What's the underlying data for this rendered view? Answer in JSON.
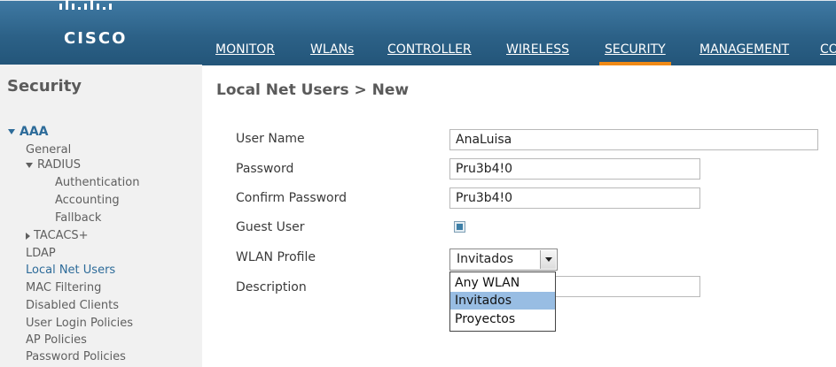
{
  "brand": {
    "name": "CISCO"
  },
  "nav": {
    "items": [
      {
        "label": "MONITOR"
      },
      {
        "label": "WLANs"
      },
      {
        "label": "CONTROLLER"
      },
      {
        "label": "WIRELESS"
      },
      {
        "label": "SECURITY",
        "active": true
      },
      {
        "label": "MANAGEMENT"
      },
      {
        "label": "CO"
      }
    ],
    "active_underline_color": "#f08a16"
  },
  "sidebar": {
    "title": "Security",
    "aaa": "AAA",
    "general": "General",
    "radius": "RADIUS",
    "authentication": "Authentication",
    "accounting": "Accounting",
    "fallback": "Fallback",
    "tacacs": "TACACS+",
    "ldap": "LDAP",
    "local_net_users": "Local Net Users",
    "mac_filtering": "MAC Filtering",
    "disabled_clients": "Disabled Clients",
    "user_login_policies": "User Login Policies",
    "ap_policies": "AP Policies",
    "password_policies": "Password Policies"
  },
  "main": {
    "title": "Local Net Users > New",
    "form": {
      "user_name_label": "User Name",
      "user_name_value": "AnaLuisa",
      "password_label": "Password",
      "password_value": "Pru3b4!0",
      "confirm_password_label": "Confirm Password",
      "confirm_password_value": "Pru3b4!0",
      "guest_user_label": "Guest User",
      "guest_user_checked": true,
      "wlan_profile_label": "WLAN Profile",
      "wlan_profile_value": "Invitados",
      "description_label": "Description",
      "description_value": "",
      "wlan_options": [
        "Any WLAN",
        "Invitados",
        "Proyectos"
      ]
    }
  }
}
